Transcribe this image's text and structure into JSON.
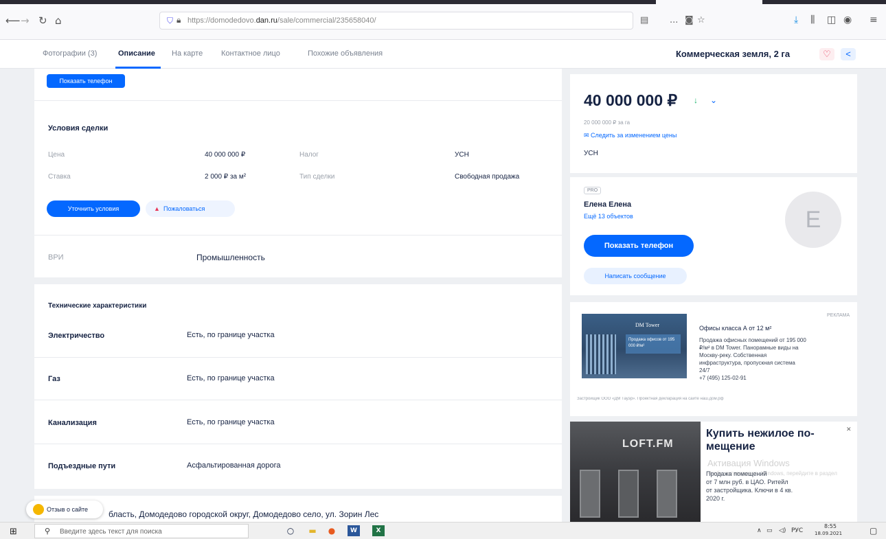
{
  "browser": {
    "url_prefix": "https://domodedovo.",
    "url_domain": "dan.ru",
    "url_path": "/sale/commercial/235658040/",
    "more_icon": "..."
  },
  "subnav": {
    "tabs": [
      "Фотографии (3)",
      "Описание",
      "На карте",
      "Контактное лицо",
      "Похожие объявления"
    ],
    "active_tab": "Описание",
    "page_title": "Коммерческая земля, 2 га"
  },
  "main": {
    "show_phone_top": "Показать телефон",
    "deal_title": "Условия сделки",
    "deal_rows": [
      {
        "label": "Цена",
        "value": "40 000 000 ₽",
        "label2": "Налог",
        "value2": "УСН"
      },
      {
        "label": "Ставка",
        "value": "2 000 ₽ за м²",
        "label2": "Тип сделки",
        "value2": "Свободная продажа"
      }
    ],
    "clarify_btn": "Уточнить условия",
    "complain_btn": "Пожаловаться",
    "vri_label": "ВРИ",
    "vri_value": "Промышленность",
    "tech_title": "Технические характеристики",
    "tech_rows": [
      {
        "label": "Электричество",
        "value": "Есть, по границе участка"
      },
      {
        "label": "Газ",
        "value": "Есть, по границе участка"
      },
      {
        "label": "Канализация",
        "value": "Есть, по границе участка"
      },
      {
        "label": "Подъездные пути",
        "value": "Асфальтированная дорога"
      }
    ],
    "address": "бласть, Домодедово городской округ, Домодедово село, ул. Зорин Лес",
    "feedback": "Отзыв о сайте"
  },
  "price_card": {
    "price": "40 000 000 ₽",
    "per_ha": "20 000 000 ₽ за га",
    "track": "Следить за изменением цены",
    "tax": "УСН"
  },
  "agent_card": {
    "badge": "PRO",
    "name": "Елена Елена",
    "more": "Ещё 13 объектов",
    "avatar_letter": "Е",
    "show_phone": "Показать телефон",
    "write": "Написать сообщение"
  },
  "ad1": {
    "label": "РЕКЛАМА",
    "img_brand": "DM Tower",
    "img_caption": "Продажа офисов от 195 000 ₽/м²",
    "title": "Офисы класса А от 12 м²",
    "text": [
      "Продажа офисных помещений от 195 000",
      "₽/м² в DM Tower. Панорамные виды на",
      "Москву-реку. Собственная",
      "инфраструктура, пропускная система",
      "24/7"
    ],
    "phone": "+7 (495) 125-02-91",
    "footer": "Застройщик ООО «ДМ Тауэр». Проектная декларация на сайте наш.дом.рф"
  },
  "ad2": {
    "img_brand": "LOFT.FM",
    "title_line1": "Купить нежилое по-",
    "title_line2": "мещение",
    "text": [
      "Продажа помещений",
      "от 7 млн руб. в ЦАО. Ритейл",
      "от застройщика. Ключи в 4 кв.",
      "2020 г."
    ],
    "close": "✕",
    "watermark1": "Активация Windows",
    "watermark2": "Чтобы активировать Windows, перейдите в раздел"
  },
  "taskbar": {
    "search_placeholder": "Введите здесь текст для поиска",
    "lang": "РУС",
    "time": "8:55",
    "date": "18.09.2021"
  }
}
